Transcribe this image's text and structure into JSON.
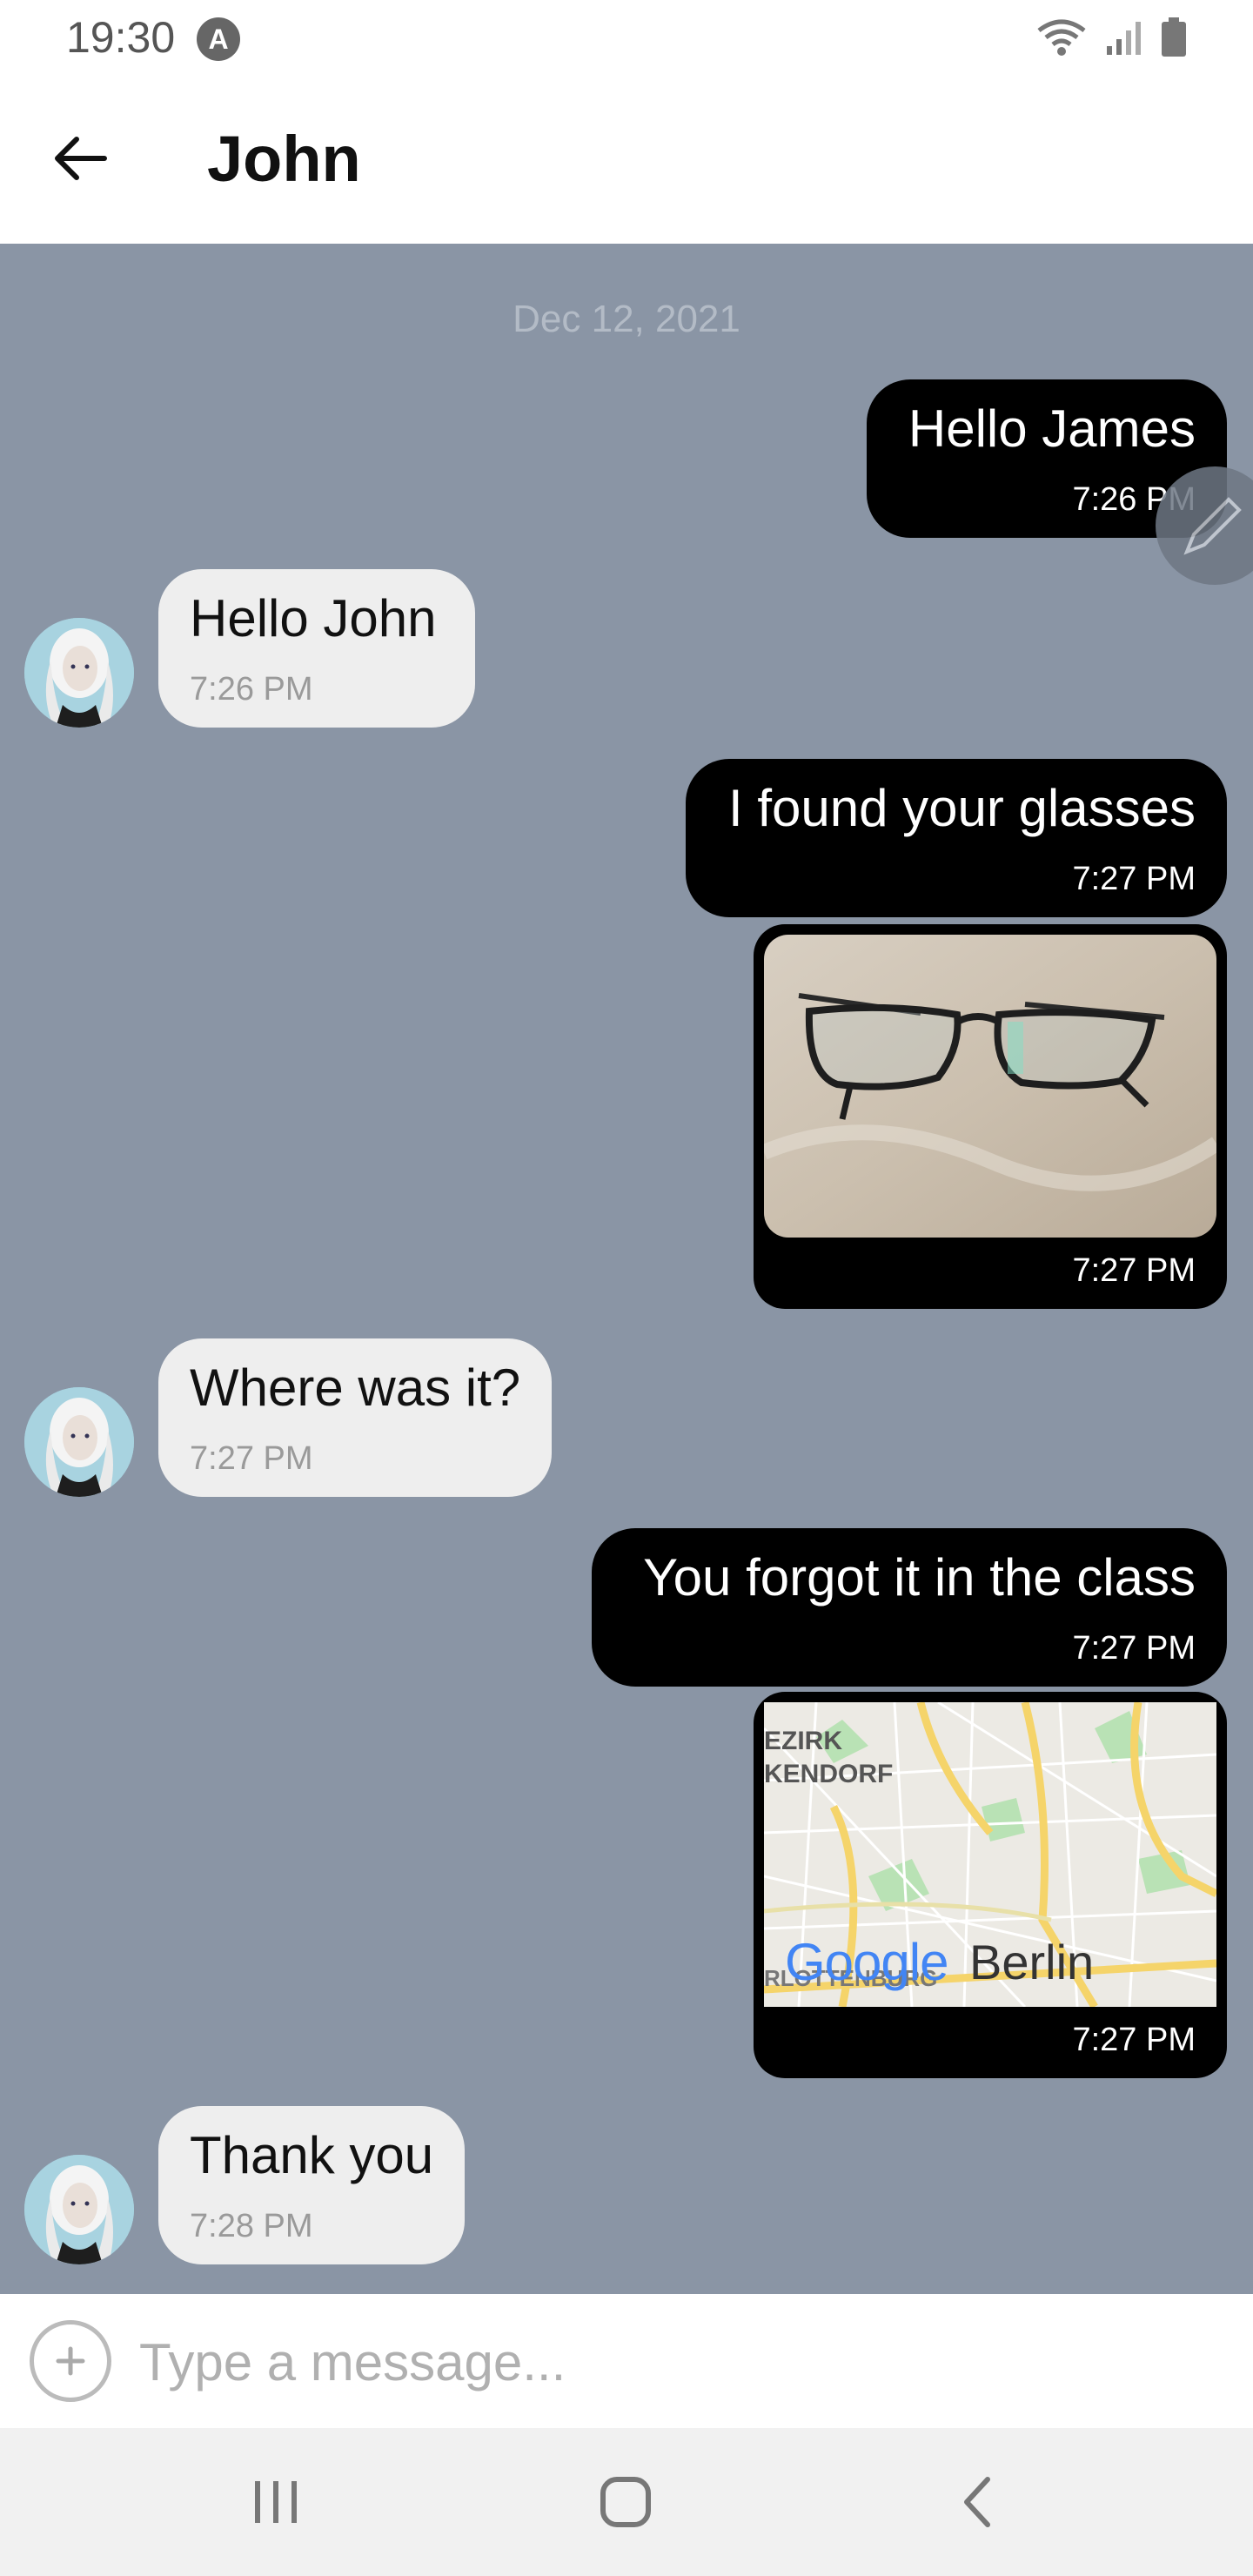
{
  "status_bar": {
    "time": "19:30",
    "notification_badge": "A",
    "icons": [
      "wifi-icon",
      "signal-icon",
      "battery-icon"
    ]
  },
  "header": {
    "title": "John",
    "back_icon": "arrow-left-icon"
  },
  "chat": {
    "date_separator": "Dec 12, 2021",
    "messages": [
      {
        "direction": "outgoing",
        "text": "Hello James",
        "time": "7:26 PM"
      },
      {
        "direction": "incoming",
        "text": "Hello John",
        "time": "7:26 PM"
      },
      {
        "direction": "outgoing",
        "text": "I found your glasses",
        "time": "7:27 PM"
      },
      {
        "direction": "outgoing",
        "type": "image",
        "time": "7:27 PM",
        "image": "eyeglasses-photo"
      },
      {
        "direction": "incoming",
        "text": "Where was it?",
        "time": "7:27 PM"
      },
      {
        "direction": "outgoing",
        "text": "You forgot it in the class",
        "time": "7:27 PM"
      },
      {
        "direction": "outgoing",
        "type": "location",
        "time": "7:27 PM",
        "map_labels": [
          "EZIRK",
          "KENDORF",
          "RLOTTENBURG"
        ],
        "map_logo": "Google",
        "map_city": "Berlin"
      },
      {
        "direction": "incoming",
        "text": "Thank you",
        "time": "7:28 PM"
      }
    ]
  },
  "composer": {
    "placeholder": "Type a message...",
    "attach_icon": "plus-circle-icon"
  },
  "nav_bar": {
    "icons": [
      "recents-icon",
      "home-icon",
      "back-icon"
    ]
  },
  "colors": {
    "chat_background": "#8a95a5",
    "outgoing_bubble": "#000000",
    "incoming_bubble": "#eeeeee"
  }
}
